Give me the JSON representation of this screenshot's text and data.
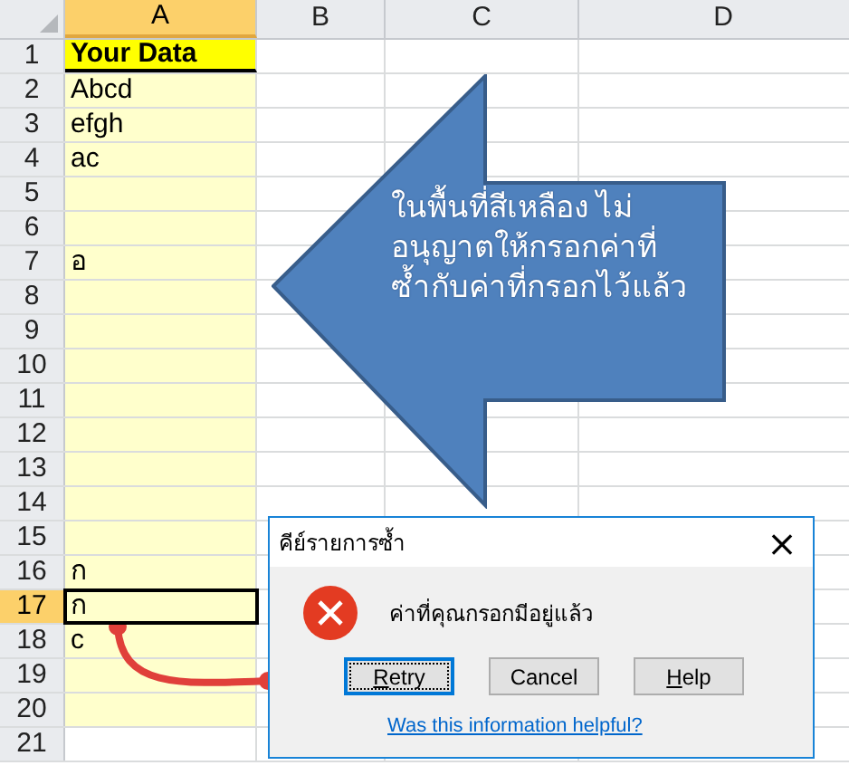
{
  "columns": [
    {
      "label": "A",
      "selected": true
    },
    {
      "label": "B",
      "selected": false
    },
    {
      "label": "C",
      "selected": false
    },
    {
      "label": "D",
      "selected": false
    }
  ],
  "rows": [
    {
      "number": "1",
      "value": "Your Data",
      "kind": "title",
      "selected": false
    },
    {
      "number": "2",
      "value": "Abcd",
      "kind": "data",
      "selected": false
    },
    {
      "number": "3",
      "value": "efgh",
      "kind": "data",
      "selected": false
    },
    {
      "number": "4",
      "value": "ac",
      "kind": "data",
      "selected": false
    },
    {
      "number": "5",
      "kind": "data",
      "selected": false
    },
    {
      "number": "6",
      "kind": "data",
      "selected": false
    },
    {
      "number": "7",
      "value": "อ",
      "kind": "data",
      "selected": false
    },
    {
      "number": "8",
      "kind": "data",
      "selected": false
    },
    {
      "number": "9",
      "kind": "data",
      "selected": false
    },
    {
      "number": "10",
      "kind": "data",
      "selected": false
    },
    {
      "number": "11",
      "kind": "data",
      "selected": false
    },
    {
      "number": "12",
      "kind": "data",
      "selected": false
    },
    {
      "number": "13",
      "kind": "data",
      "selected": false
    },
    {
      "number": "14",
      "kind": "data",
      "selected": false
    },
    {
      "number": "15",
      "kind": "data",
      "selected": false
    },
    {
      "number": "16",
      "value": "ก",
      "kind": "data",
      "selected": false
    },
    {
      "number": "17",
      "value": "ก",
      "kind": "data",
      "selected": true
    },
    {
      "number": "18",
      "value": "c",
      "kind": "data",
      "selected": false
    },
    {
      "number": "19",
      "kind": "data",
      "selected": false
    },
    {
      "number": "20",
      "kind": "data",
      "selected": false
    },
    {
      "number": "21",
      "kind": "plain",
      "selected": false
    }
  ],
  "callout": {
    "text": "ในพื้นที่สีเหลือง  ไม่อนุญาตให้กรอกค่าที่ซ้ำกับค่าที่กรอกไว้แล้ว"
  },
  "dialog": {
    "title": "คีย์รายการซ้ำ",
    "close": "×",
    "message": "ค่าที่คุณกรอกมีอยู่แล้ว",
    "buttons": [
      {
        "label": "Retry",
        "underlined_first": true,
        "focused": true
      },
      {
        "label": "Cancel",
        "underlined_first": false,
        "focused": false
      },
      {
        "label": "Help",
        "underlined_first": true,
        "focused": false
      }
    ],
    "link": "Was this information helpful?"
  }
}
